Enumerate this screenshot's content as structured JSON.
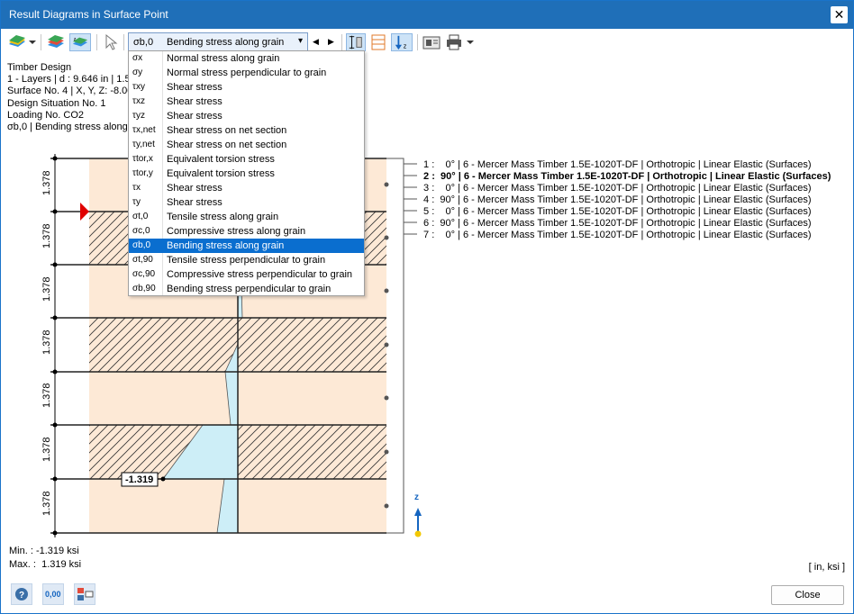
{
  "window": {
    "title": "Result Diagrams in Surface Point"
  },
  "combo": {
    "symbol": "σb,0",
    "label": "Bending stress along grain"
  },
  "info": {
    "lines": [
      "Timber Design",
      "1 - Layers | d : 9.646 in | 1.5",
      "Surface No. 4 | X, Y, Z: -8.00",
      "Design Situation No. 1",
      "Loading No. CO2",
      "σb,0 | Bending stress along"
    ]
  },
  "dropdown": {
    "items": [
      {
        "sym": "σx",
        "desc": "Normal stress along grain"
      },
      {
        "sym": "σy",
        "desc": "Normal stress perpendicular to grain"
      },
      {
        "sym": "τxy",
        "desc": "Shear stress"
      },
      {
        "sym": "τxz",
        "desc": "Shear stress"
      },
      {
        "sym": "τyz",
        "desc": "Shear stress"
      },
      {
        "sym": "τx,net",
        "desc": "Shear stress on net section"
      },
      {
        "sym": "τy,net",
        "desc": "Shear stress on net section"
      },
      {
        "sym": "τtor,x",
        "desc": "Equivalent torsion stress"
      },
      {
        "sym": "τtor,y",
        "desc": "Equivalent torsion stress"
      },
      {
        "sym": "τx",
        "desc": "Shear stress"
      },
      {
        "sym": "τy",
        "desc": "Shear stress"
      },
      {
        "sym": "σt,0",
        "desc": "Tensile stress along grain"
      },
      {
        "sym": "σc,0",
        "desc": "Compressive stress along grain"
      },
      {
        "sym": "σb,0",
        "desc": "Bending stress along grain"
      },
      {
        "sym": "σt,90",
        "desc": "Tensile stress perpendicular to grain"
      },
      {
        "sym": "σc,90",
        "desc": "Compressive stress perpendicular to grain"
      },
      {
        "sym": "σb,90",
        "desc": "Bending stress perpendicular to grain"
      }
    ],
    "selected_index": 13
  },
  "diagram": {
    "layer_thickness_label": "1.378",
    "layer_count": 7,
    "min_label": "-1.319",
    "axis_label": "z"
  },
  "legend": {
    "items": [
      " 1 :    0° | 6 - Mercer Mass Timber 1.5E-1020T-DF | Orthotropic | Linear Elastic (Surfaces)",
      " 2 :  90° | 6 - Mercer Mass Timber 1.5E-1020T-DF | Orthotropic | Linear Elastic (Surfaces)",
      " 3 :    0° | 6 - Mercer Mass Timber 1.5E-1020T-DF | Orthotropic | Linear Elastic (Surfaces)",
      " 4 :  90° | 6 - Mercer Mass Timber 1.5E-1020T-DF | Orthotropic | Linear Elastic (Surfaces)",
      " 5 :    0° | 6 - Mercer Mass Timber 1.5E-1020T-DF | Orthotropic | Linear Elastic (Surfaces)",
      " 6 :  90° | 6 - Mercer Mass Timber 1.5E-1020T-DF | Orthotropic | Linear Elastic (Surfaces)",
      " 7 :    0° | 6 - Mercer Mass Timber 1.5E-1020T-DF | Orthotropic | Linear Elastic (Surfaces)"
    ],
    "bold_index": 1
  },
  "summary": {
    "min_label": "Min. :",
    "min_value": "-1.319 ksi",
    "max_label": "Max. :",
    "max_value": "1.319 ksi",
    "units": "[ in, ksi ]"
  },
  "buttons": {
    "close": "Close",
    "decimals": "0,00"
  },
  "colors": {
    "title_bar": "#1f6fb8",
    "layer_fill": "#fde9d6",
    "stress_fill": "#cdeef7",
    "selected": "#0a6ecf"
  }
}
